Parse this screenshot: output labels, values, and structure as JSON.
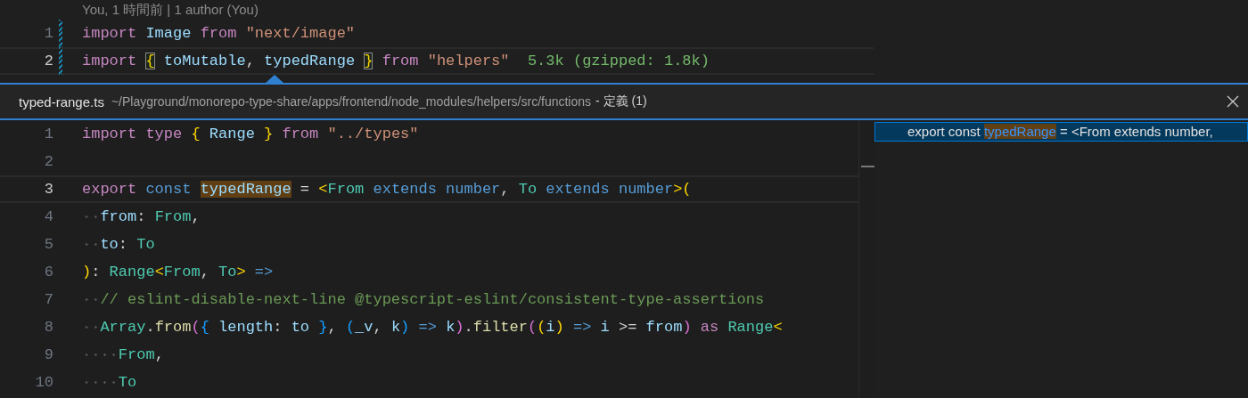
{
  "editor": {
    "codelens": "You, 1 時間前 | 1 author (You)",
    "lines": [
      {
        "number": "1",
        "current": false,
        "git_change": true,
        "tokens": [
          {
            "kind": "kw",
            "text": "import "
          },
          {
            "kind": "var",
            "text": "Image "
          },
          {
            "kind": "kw",
            "text": "from "
          },
          {
            "kind": "str",
            "text": "\"next/image\""
          }
        ]
      },
      {
        "number": "2",
        "current": true,
        "git_change": true,
        "tokens": [
          {
            "kind": "kw",
            "text": "import "
          },
          {
            "kind": "bmatch",
            "text": "{"
          },
          {
            "kind": "var",
            "text": " toMutable"
          },
          {
            "kind": "p",
            "text": ", "
          },
          {
            "kind": "var",
            "text": "typedRange "
          },
          {
            "kind": "bmatch",
            "text": "}"
          },
          {
            "kind": "kw",
            "text": " from "
          },
          {
            "kind": "str",
            "text": "\"helpers\"  "
          },
          {
            "kind": "hint",
            "text": "5.3k (gzipped: 1.8k)"
          }
        ]
      }
    ]
  },
  "peek": {
    "file": "typed-range.ts",
    "path": "~/Playground/monorepo-type-share/apps/frontend/node_modules/helpers/src/functions",
    "suffix": "- 定義 (1)",
    "lines": [
      {
        "number": "1",
        "current": false,
        "tokens": [
          {
            "kind": "kw",
            "text": "import type "
          },
          {
            "kind": "b1",
            "text": "{"
          },
          {
            "kind": "var",
            "text": " Range "
          },
          {
            "kind": "b1",
            "text": "}"
          },
          {
            "kind": "kw",
            "text": " from "
          },
          {
            "kind": "str",
            "text": "\"../types\""
          }
        ]
      },
      {
        "number": "2",
        "current": false
      },
      {
        "number": "3",
        "current": true,
        "tokens": [
          {
            "kind": "kw",
            "text": "export "
          },
          {
            "kind": "st",
            "text": "const "
          },
          {
            "kind": "match",
            "text": "typedRange"
          },
          {
            "kind": "p",
            "text": " = "
          },
          {
            "kind": "b1",
            "text": "<"
          },
          {
            "kind": "ty",
            "text": "From "
          },
          {
            "kind": "st",
            "text": "extends number"
          },
          {
            "kind": "p",
            "text": ", "
          },
          {
            "kind": "ty",
            "text": "To "
          },
          {
            "kind": "st",
            "text": "extends number"
          },
          {
            "kind": "b1",
            "text": ">("
          }
        ]
      },
      {
        "number": "4",
        "current": false,
        "tokens": [
          {
            "kind": "var",
            "text": "  from"
          },
          {
            "kind": "p",
            "text": ": "
          },
          {
            "kind": "ty",
            "text": "From"
          },
          {
            "kind": "p",
            "text": ","
          }
        ]
      },
      {
        "number": "5",
        "current": false,
        "tokens": [
          {
            "kind": "var",
            "text": "  to"
          },
          {
            "kind": "p",
            "text": ": "
          },
          {
            "kind": "ty",
            "text": "To"
          }
        ]
      },
      {
        "number": "6",
        "current": false,
        "tokens": [
          {
            "kind": "b1",
            "text": ")"
          },
          {
            "kind": "p",
            "text": ": "
          },
          {
            "kind": "ty",
            "text": "Range"
          },
          {
            "kind": "b1",
            "text": "<"
          },
          {
            "kind": "ty",
            "text": "From"
          },
          {
            "kind": "p",
            "text": ", "
          },
          {
            "kind": "ty",
            "text": "To"
          },
          {
            "kind": "b1",
            "text": ">"
          },
          {
            "kind": "st",
            "text": " =>"
          }
        ]
      },
      {
        "number": "7",
        "current": false,
        "tokens": [
          {
            "kind": "cm",
            "text": "  // eslint-disable-next-line @typescript-eslint/consistent-type-assertions"
          }
        ]
      },
      {
        "number": "8",
        "current": false,
        "tokens": [
          {
            "kind": "ty",
            "text": "  Array"
          },
          {
            "kind": "p",
            "text": "."
          },
          {
            "kind": "fn",
            "text": "from"
          },
          {
            "kind": "b2",
            "text": "("
          },
          {
            "kind": "b3",
            "text": "{"
          },
          {
            "kind": "var",
            "text": " length"
          },
          {
            "kind": "p",
            "text": ": "
          },
          {
            "kind": "var",
            "text": "to "
          },
          {
            "kind": "b3",
            "text": "}"
          },
          {
            "kind": "p",
            "text": ", "
          },
          {
            "kind": "b3",
            "text": "("
          },
          {
            "kind": "var",
            "text": "_v"
          },
          {
            "kind": "p",
            "text": ", "
          },
          {
            "kind": "var",
            "text": "k"
          },
          {
            "kind": "b3",
            "text": ")"
          },
          {
            "kind": "st",
            "text": " => "
          },
          {
            "kind": "var",
            "text": "k"
          },
          {
            "kind": "b2",
            "text": ")"
          },
          {
            "kind": "p",
            "text": "."
          },
          {
            "kind": "fn",
            "text": "filter"
          },
          {
            "kind": "b2",
            "text": "("
          },
          {
            "kind": "b1",
            "text": "("
          },
          {
            "kind": "var",
            "text": "i"
          },
          {
            "kind": "b1",
            "text": ")"
          },
          {
            "kind": "st",
            "text": " => "
          },
          {
            "kind": "var",
            "text": "i"
          },
          {
            "kind": "p",
            "text": " >= "
          },
          {
            "kind": "var",
            "text": "from"
          },
          {
            "kind": "b2",
            "text": ")"
          },
          {
            "kind": "kw",
            "text": " as "
          },
          {
            "kind": "ty",
            "text": "Range"
          },
          {
            "kind": "b1",
            "text": "<"
          }
        ]
      },
      {
        "number": "9",
        "current": false,
        "tokens": [
          {
            "kind": "ty",
            "text": "    From"
          },
          {
            "kind": "p",
            "text": ","
          }
        ]
      },
      {
        "number": "10",
        "current": false,
        "tokens": [
          {
            "kind": "ty",
            "text": "    To"
          }
        ]
      }
    ],
    "references": [
      {
        "selected": true,
        "tokens": [
          {
            "kind": "p",
            "text": "export const "
          },
          {
            "kind": "refmatch",
            "text": "typedRange"
          },
          {
            "kind": "p",
            "text": " = <From extends number,"
          }
        ]
      }
    ]
  }
}
